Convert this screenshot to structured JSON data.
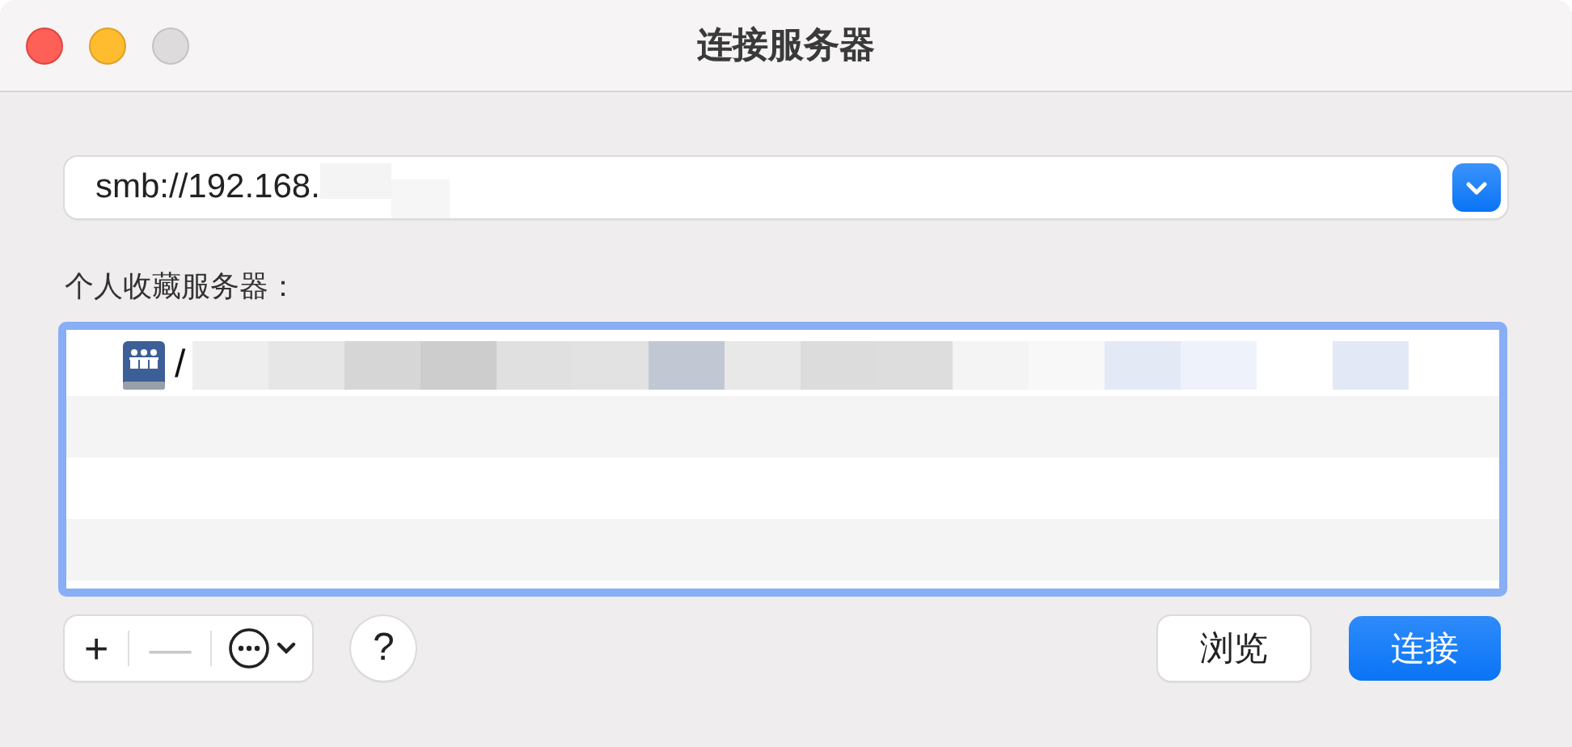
{
  "window": {
    "title": "连接服务器"
  },
  "address": {
    "value": "smb://192.168."
  },
  "favorites": {
    "label": "个人收藏服务器：",
    "focused": true,
    "items": [
      {
        "text": "/",
        "selected": false
      }
    ]
  },
  "toolbar": {
    "add": "+",
    "remove": "—",
    "help": "?"
  },
  "buttons": [
    {
      "label": "浏览",
      "default": false
    },
    {
      "label": "连接",
      "default": true
    }
  ]
}
